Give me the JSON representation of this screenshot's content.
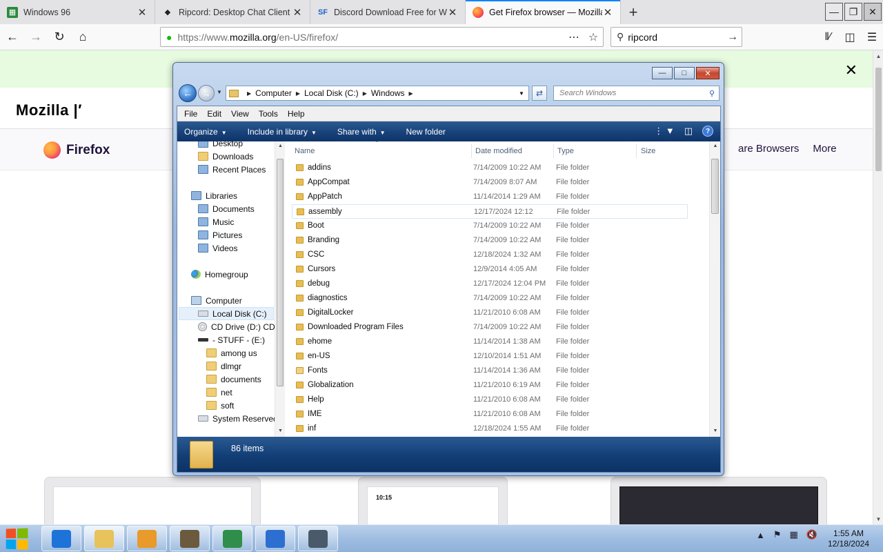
{
  "browser": {
    "tabs": [
      {
        "title": "Windows 96",
        "favicon": "win96",
        "active": false
      },
      {
        "title": "Ripcord: Desktop Chat Client",
        "favicon": "diamond",
        "active": false
      },
      {
        "title": "Discord Download Free for Wi",
        "favicon": "SF",
        "active": false
      },
      {
        "title": "Get Firefox browser — Mozilla",
        "favicon": "firefox",
        "active": true
      }
    ],
    "new_tab_label": "+",
    "url_host_prefix": "https://www.",
    "url_host": "mozilla.org",
    "url_path": "/en-US/firefox/",
    "search_value": "ripcord",
    "icons": {
      "back": "back-arrow-icon",
      "forward": "forward-arrow-icon",
      "reload": "reload-icon",
      "home": "home-icon",
      "lock": "lock-icon",
      "page_actions": "more-dots-icon",
      "bookmark": "star-icon",
      "search": "magnifier-icon",
      "library": "library-icon",
      "sidebar": "sidebar-icon",
      "menu": "hamburger-icon"
    }
  },
  "page": {
    "brand": "Mozilla",
    "product": "Firefox",
    "nav_right": [
      "are Browsers",
      "More"
    ],
    "device_time": "10:15",
    "banner_color": "#e6fbe0"
  },
  "explorer": {
    "breadcrumb": [
      "Computer",
      "Local Disk (C:)",
      "Windows"
    ],
    "search_placeholder": "Search Windows",
    "menu": [
      "File",
      "Edit",
      "View",
      "Tools",
      "Help"
    ],
    "commands": [
      "Organize",
      "Include in library",
      "Share with",
      "New folder"
    ],
    "columns": {
      "name": "Name",
      "date": "Date modified",
      "type": "Type",
      "size": "Size"
    },
    "nav_items": [
      {
        "label": "Desktop",
        "icon": "folder-blue-icon",
        "indent": 2,
        "kind": "blue"
      },
      {
        "label": "Downloads",
        "icon": "folder-icon",
        "indent": 2,
        "kind": "folder"
      },
      {
        "label": "Recent Places",
        "icon": "recent-places-icon",
        "indent": 2,
        "kind": "blue"
      },
      {
        "label": "Libraries",
        "icon": "libraries-icon",
        "indent": 1,
        "kind": "blue"
      },
      {
        "label": "Documents",
        "icon": "documents-icon",
        "indent": 2,
        "kind": "blue"
      },
      {
        "label": "Music",
        "icon": "music-icon",
        "indent": 2,
        "kind": "blue"
      },
      {
        "label": "Pictures",
        "icon": "pictures-icon",
        "indent": 2,
        "kind": "blue"
      },
      {
        "label": "Videos",
        "icon": "videos-icon",
        "indent": 2,
        "kind": "blue"
      },
      {
        "label": "Homegroup",
        "icon": "homegroup-icon",
        "indent": 1,
        "kind": "home"
      },
      {
        "label": "Computer",
        "icon": "computer-icon",
        "indent": 1,
        "kind": "pc"
      },
      {
        "label": "Local Disk (C:)",
        "icon": "drive-icon",
        "indent": 2,
        "kind": "drive",
        "selected": true
      },
      {
        "label": "CD Drive (D:) CDR",
        "icon": "cd-drive-icon",
        "indent": 2,
        "kind": "cd"
      },
      {
        "label": "- STUFF - (E:)",
        "icon": "removable-drive-icon",
        "indent": 2,
        "kind": "dark"
      },
      {
        "label": "among us",
        "icon": "folder-icon",
        "indent": 3,
        "kind": "folder"
      },
      {
        "label": "dlmgr",
        "icon": "folder-icon",
        "indent": 3,
        "kind": "folder"
      },
      {
        "label": "documents",
        "icon": "folder-icon",
        "indent": 3,
        "kind": "folder"
      },
      {
        "label": "net",
        "icon": "folder-icon",
        "indent": 3,
        "kind": "folder"
      },
      {
        "label": "soft",
        "icon": "folder-icon",
        "indent": 3,
        "kind": "folder"
      },
      {
        "label": "System Reserved (",
        "icon": "drive-icon",
        "indent": 2,
        "kind": "drive"
      }
    ],
    "files": [
      {
        "name": "addins",
        "date": "7/14/2009 10:22 AM",
        "type": "File folder"
      },
      {
        "name": "AppCompat",
        "date": "7/14/2009 8:07 AM",
        "type": "File folder"
      },
      {
        "name": "AppPatch",
        "date": "11/14/2014 1:29 AM",
        "type": "File folder"
      },
      {
        "name": "assembly",
        "date": "12/17/2024 12:12",
        "type": "File folder",
        "hover": true
      },
      {
        "name": "Boot",
        "date": "7/14/2009 10:22 AM",
        "type": "File folder"
      },
      {
        "name": "Branding",
        "date": "7/14/2009 10:22 AM",
        "type": "File folder"
      },
      {
        "name": "CSC",
        "date": "12/18/2024 1:32 AM",
        "type": "File folder"
      },
      {
        "name": "Cursors",
        "date": "12/9/2014 4:05 AM",
        "type": "File folder"
      },
      {
        "name": "debug",
        "date": "12/17/2024 12:04 PM",
        "type": "File folder"
      },
      {
        "name": "diagnostics",
        "date": "7/14/2009 10:22 AM",
        "type": "File folder"
      },
      {
        "name": "DigitalLocker",
        "date": "11/21/2010 6:08 AM",
        "type": "File folder"
      },
      {
        "name": "Downloaded Program Files",
        "date": "7/14/2009 10:22 AM",
        "type": "File folder"
      },
      {
        "name": "ehome",
        "date": "11/14/2014 1:38 AM",
        "type": "File folder"
      },
      {
        "name": "en-US",
        "date": "12/10/2014 1:51 AM",
        "type": "File folder"
      },
      {
        "name": "Fonts",
        "date": "11/14/2014 1:36 AM",
        "type": "File folder",
        "special": "fonts"
      },
      {
        "name": "Globalization",
        "date": "11/21/2010 6:19 AM",
        "type": "File folder"
      },
      {
        "name": "Help",
        "date": "11/21/2010 6:08 AM",
        "type": "File folder"
      },
      {
        "name": "IME",
        "date": "11/21/2010 6:08 AM",
        "type": "File folder"
      },
      {
        "name": "inf",
        "date": "12/18/2024 1:55 AM",
        "type": "File folder"
      }
    ],
    "item_count": "86 items"
  },
  "taskbar": {
    "time": "1:55 AM",
    "date": "12/18/2024",
    "apps": [
      {
        "name": "internet-explorer-icon",
        "color": "#1e73d8"
      },
      {
        "name": "file-explorer-icon",
        "color": "#e8c25a",
        "active": true
      },
      {
        "name": "media-player-icon",
        "color": "#e89a2a"
      },
      {
        "name": "raccoon-app-icon",
        "color": "#6b5a3e"
      },
      {
        "name": "installer-app-icon",
        "color": "#2f8f4a"
      },
      {
        "name": "browser-globe-icon",
        "color": "#2d6fd1"
      },
      {
        "name": "network-computer-icon",
        "color": "#4a5a6a"
      }
    ]
  }
}
